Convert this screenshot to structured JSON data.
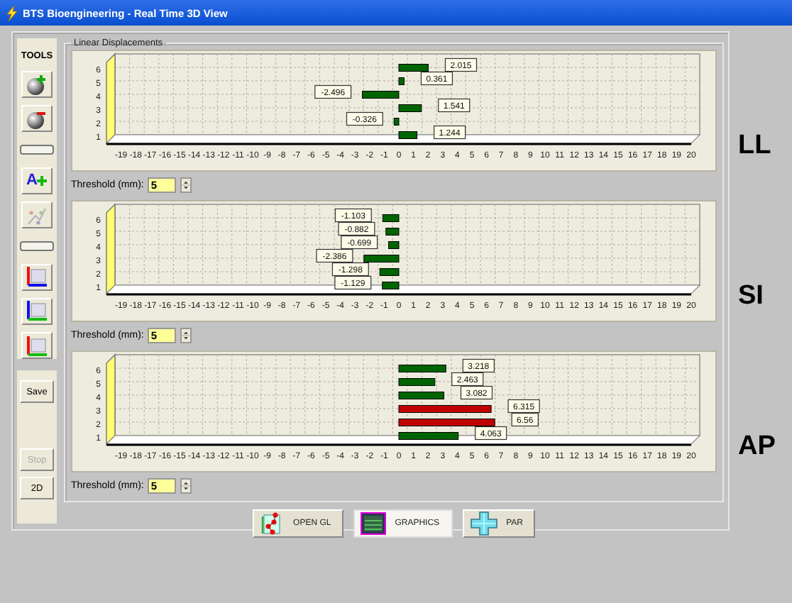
{
  "window": {
    "title": "BTS Bioengineering - Real Time 3D View"
  },
  "tools": {
    "heading": "TOOLS",
    "items": [
      {
        "kind": "button"
      },
      {
        "kind": "button"
      },
      {
        "kind": "separator"
      },
      {
        "kind": "button",
        "label": "A"
      },
      {
        "kind": "button"
      },
      {
        "kind": "separator"
      },
      {
        "kind": "button"
      },
      {
        "kind": "button"
      },
      {
        "kind": "button"
      }
    ]
  },
  "actions": [
    {
      "label": "Save",
      "disabled": false
    },
    {
      "label": "Stop",
      "disabled": true
    },
    {
      "label": "2D",
      "disabled": false
    }
  ],
  "group": {
    "title": "Linear Displacements"
  },
  "charts": [
    {
      "axis_label": "LL",
      "threshold": {
        "label": "Threshold (mm):",
        "value": "5"
      },
      "chart_data": {
        "type": "bar",
        "orientation": "horizontal",
        "stacked": true,
        "data_labels": true,
        "categories": [
          "6",
          "5",
          "4",
          "3",
          "2",
          "1"
        ],
        "xlim": [
          -20,
          20
        ],
        "xticks": [
          -19,
          -18,
          -17,
          -16,
          -15,
          -14,
          -13,
          -12,
          -11,
          -10,
          -9,
          -8,
          -7,
          -6,
          -5,
          -4,
          -3,
          -2,
          -1,
          0,
          1,
          2,
          3,
          4,
          5,
          6,
          7,
          8,
          9,
          10,
          11,
          12,
          13,
          14,
          15,
          16,
          17,
          18,
          19,
          20
        ],
        "series": [
          {
            "color": "#006400",
            "values": [
              2.015,
              0.361,
              -2.496,
              1.541,
              -0.326,
              1.244
            ]
          }
        ]
      }
    },
    {
      "axis_label": "SI",
      "threshold": {
        "label": "Threshold (mm):",
        "value": "5"
      },
      "chart_data": {
        "type": "bar",
        "orientation": "horizontal",
        "stacked": true,
        "data_labels": true,
        "categories": [
          "6",
          "5",
          "4",
          "3",
          "2",
          "1"
        ],
        "xlim": [
          -20,
          20
        ],
        "xticks": [
          -19,
          -18,
          -17,
          -16,
          -15,
          -14,
          -13,
          -12,
          -11,
          -10,
          -9,
          -8,
          -7,
          -6,
          -5,
          -4,
          -3,
          -2,
          -1,
          0,
          1,
          2,
          3,
          4,
          5,
          6,
          7,
          8,
          9,
          10,
          11,
          12,
          13,
          14,
          15,
          16,
          17,
          18,
          19,
          20
        ],
        "series": [
          {
            "color": "#006400",
            "values": [
              -1.103,
              -0.882,
              -0.699,
              -2.386,
              -1.298,
              -1.129
            ]
          }
        ]
      }
    },
    {
      "axis_label": "AP",
      "threshold": {
        "label": "Threshold (mm):",
        "value": "5"
      },
      "chart_data": {
        "type": "bar",
        "orientation": "horizontal",
        "stacked": true,
        "data_labels": true,
        "categories": [
          "6",
          "5",
          "4",
          "3",
          "2",
          "1"
        ],
        "xlim": [
          -20,
          20
        ],
        "xticks": [
          -19,
          -18,
          -17,
          -16,
          -15,
          -14,
          -13,
          -12,
          -11,
          -10,
          -9,
          -8,
          -7,
          -6,
          -5,
          -4,
          -3,
          -2,
          -1,
          0,
          1,
          2,
          3,
          4,
          5,
          6,
          7,
          8,
          9,
          10,
          11,
          12,
          13,
          14,
          15,
          16,
          17,
          18,
          19,
          20
        ],
        "series": [
          {
            "color": "#006400",
            "values": [
              3.218,
              2.463,
              3.082,
              null,
              null,
              4.063
            ]
          },
          {
            "color": "#c00000",
            "values": [
              null,
              null,
              null,
              6.315,
              6.56,
              null
            ]
          }
        ]
      }
    }
  ],
  "bottom_buttons": [
    {
      "label": "OPEN GL",
      "selected": false
    },
    {
      "label": "GRAPHICS",
      "selected": true
    },
    {
      "label": "PAR",
      "selected": false
    }
  ]
}
